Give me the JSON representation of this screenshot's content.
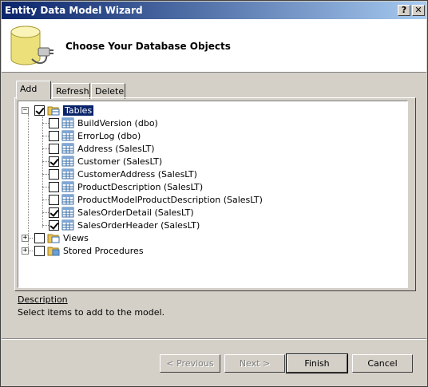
{
  "window": {
    "title": "Entity Data Model Wizard",
    "help_btn": "?",
    "close_btn": "✕"
  },
  "header": {
    "title": "Choose Your Database Objects"
  },
  "tabs": [
    {
      "label": "Add",
      "active": true
    },
    {
      "label": "Refresh",
      "active": false
    },
    {
      "label": "Delete",
      "active": false
    }
  ],
  "tree": {
    "tables": {
      "label": "Tables",
      "checked": true,
      "expanded": true,
      "expander": "−",
      "items": [
        {
          "label": "BuildVersion (dbo)",
          "checked": false
        },
        {
          "label": "ErrorLog (dbo)",
          "checked": false
        },
        {
          "label": "Address (SalesLT)",
          "checked": false
        },
        {
          "label": "Customer (SalesLT)",
          "checked": true
        },
        {
          "label": "CustomerAddress (SalesLT)",
          "checked": false
        },
        {
          "label": "ProductDescription (SalesLT)",
          "checked": false
        },
        {
          "label": "ProductModelProductDescription (SalesLT)",
          "checked": false
        },
        {
          "label": "SalesOrderDetail (SalesLT)",
          "checked": true
        },
        {
          "label": "SalesOrderHeader (SalesLT)",
          "checked": true
        }
      ]
    },
    "views": {
      "label": "Views",
      "checked": false,
      "expander": "+"
    },
    "stored_procedures": {
      "label": "Stored Procedures",
      "checked": false,
      "expander": "+"
    }
  },
  "description": {
    "heading": "Description",
    "text": "Select items to add to the model."
  },
  "buttons": {
    "previous": "< Previous",
    "next": "Next >",
    "finish": "Finish",
    "cancel": "Cancel"
  },
  "colors": {
    "selection": "#0a246a",
    "titlebar_start": "#0a246a",
    "titlebar_end": "#a6caf0"
  }
}
